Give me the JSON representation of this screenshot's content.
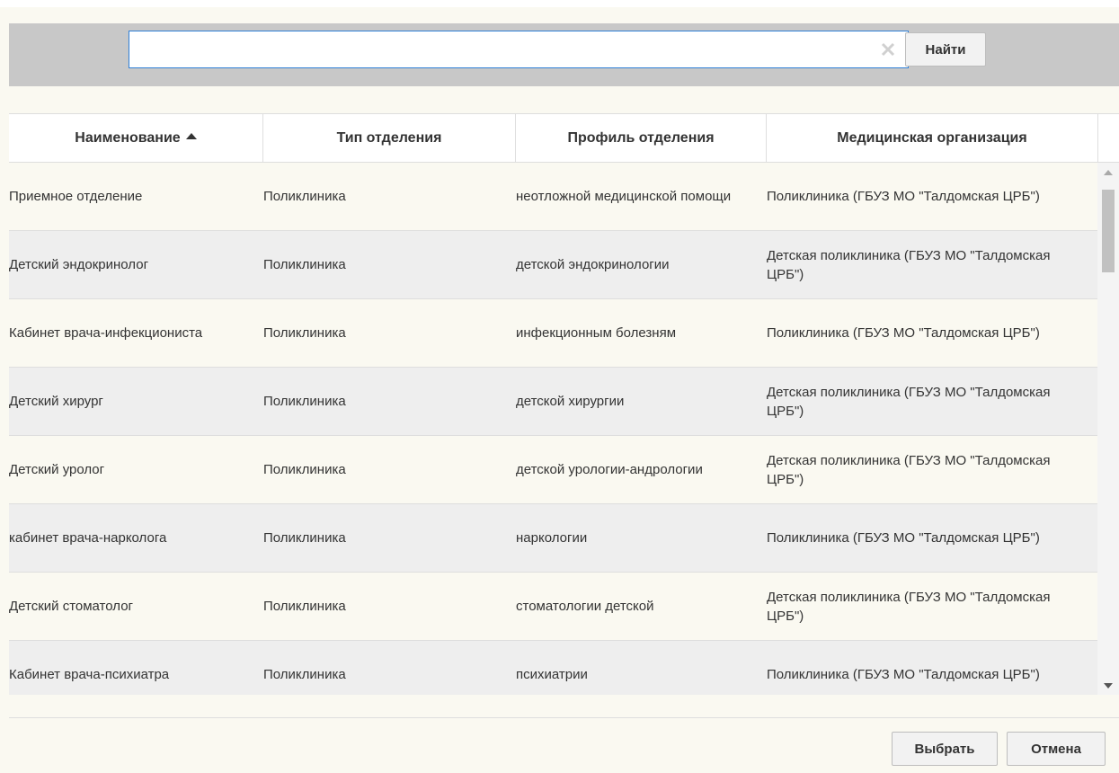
{
  "search": {
    "value": "",
    "placeholder": "",
    "find_label": "Найти"
  },
  "table": {
    "columns": [
      {
        "label": "Наименование",
        "sorted": "asc"
      },
      {
        "label": "Тип отделения"
      },
      {
        "label": "Профиль отделения"
      },
      {
        "label": "Медицинская организация"
      }
    ],
    "rows": [
      [
        "Приемное отделение",
        "Поликлиника",
        "неотложной медицинской помощи",
        "Поликлиника (ГБУЗ МО \"Талдомская ЦРБ\")"
      ],
      [
        "Детский эндокринолог",
        "Поликлиника",
        "детской эндокринологии",
        "Детская поликлиника (ГБУЗ МО \"Талдомская ЦРБ\")"
      ],
      [
        "Кабинет врача-инфекциониста",
        "Поликлиника",
        "инфекционным болезням",
        "Поликлиника (ГБУЗ МО \"Талдомская ЦРБ\")"
      ],
      [
        "Детский хирург",
        "Поликлиника",
        "детской хирургии",
        "Детская поликлиника (ГБУЗ МО \"Талдомская ЦРБ\")"
      ],
      [
        "Детский уролог",
        "Поликлиника",
        "детской урологии-андрологии",
        "Детская поликлиника (ГБУЗ МО \"Талдомская ЦРБ\")"
      ],
      [
        "кабинет врача-нарколога",
        "Поликлиника",
        "наркологии",
        "Поликлиника (ГБУЗ МО \"Талдомская ЦРБ\")"
      ],
      [
        "Детский стоматолог",
        "Поликлиника",
        "стоматологии детской",
        "Детская поликлиника (ГБУЗ МО \"Талдомская ЦРБ\")"
      ],
      [
        "Кабинет врача-психиатра",
        "Поликлиника",
        "психиатрии",
        "Поликлиника (ГБУЗ МО \"Талдомская ЦРБ\")"
      ]
    ]
  },
  "footer": {
    "select_label": "Выбрать",
    "cancel_label": "Отмена"
  },
  "icons": {
    "clear": "clear-icon",
    "sort": "sort-ascending-icon",
    "scroll_up": "scroll-up-arrow-icon",
    "scroll_down": "scroll-down-arrow-icon"
  },
  "colors": {
    "search_bar_bg": "#c8c8c8",
    "input_border": "#2f7fd6",
    "row_odd": "#faf9f1",
    "row_even": "#eeeeee"
  }
}
